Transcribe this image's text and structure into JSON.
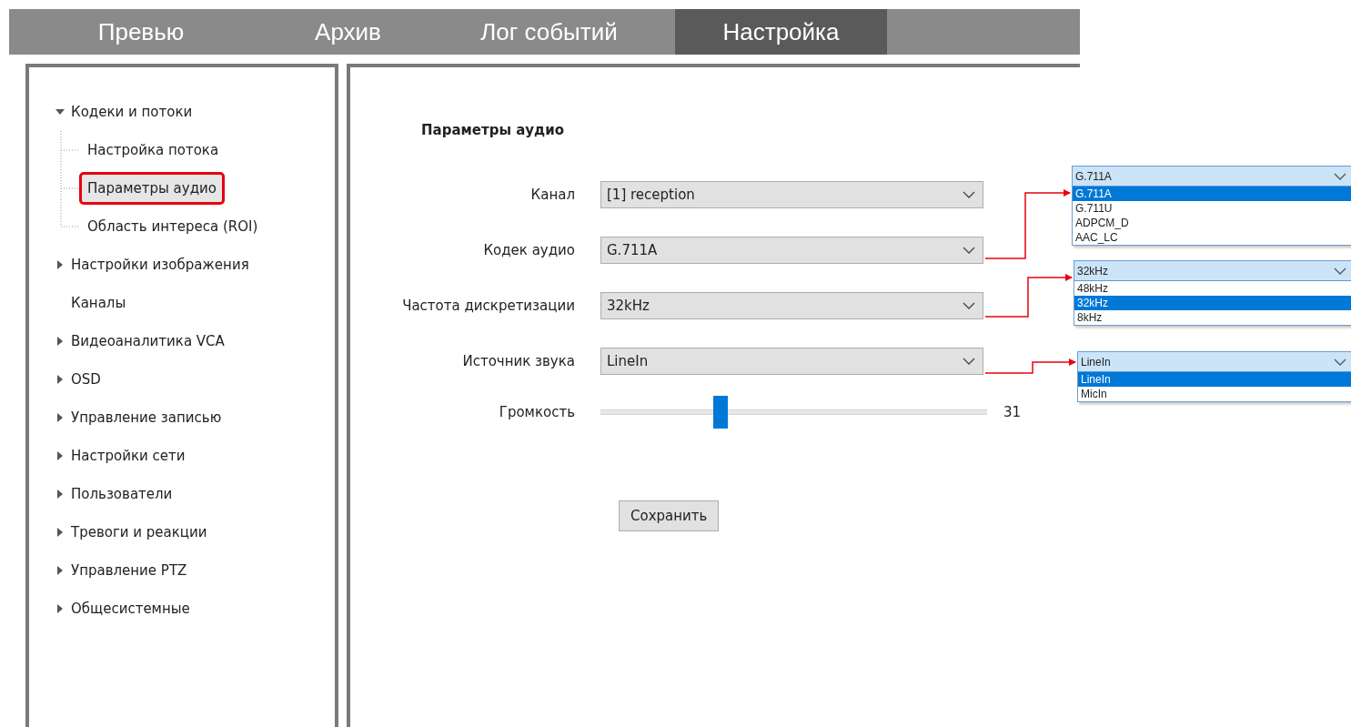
{
  "tabs": [
    {
      "label": "Превью",
      "selected": false
    },
    {
      "label": "Архив",
      "selected": false
    },
    {
      "label": "Лог событий",
      "selected": false
    },
    {
      "label": "Настройка",
      "selected": true
    }
  ],
  "sidebar": {
    "items": [
      {
        "label": "Кодеки и потоки",
        "kind": "folder",
        "expanded": true,
        "children": [
          {
            "label": "Настройка потока",
            "selected": false,
            "annotated": false
          },
          {
            "label": "Параметры аудио",
            "selected": true,
            "annotated": true
          },
          {
            "label": "Область интереса (ROI)",
            "selected": false,
            "annotated": false
          }
        ]
      },
      {
        "label": "Настройки изображения",
        "kind": "folder",
        "expanded": false
      },
      {
        "label": "Каналы",
        "kind": "leaf"
      },
      {
        "label": "Видеоаналитика VCA",
        "kind": "folder",
        "expanded": false
      },
      {
        "label": "OSD",
        "kind": "folder",
        "expanded": false
      },
      {
        "label": "Управление записью",
        "kind": "folder",
        "expanded": false
      },
      {
        "label": "Настройки сети",
        "kind": "folder",
        "expanded": false
      },
      {
        "label": "Пользователи",
        "kind": "folder",
        "expanded": false
      },
      {
        "label": "Тревоги и реакции",
        "kind": "folder",
        "expanded": false
      },
      {
        "label": "Управление PTZ",
        "kind": "folder",
        "expanded": false
      },
      {
        "label": "Общесистемные",
        "kind": "folder",
        "expanded": false
      }
    ]
  },
  "form": {
    "title": "Параметры аудио",
    "fields": [
      {
        "label": "Канал",
        "value": "[1] reception"
      },
      {
        "label": "Кодек аудио",
        "value": "G.711A",
        "callout": {
          "value": "G.711A",
          "options": [
            {
              "label": "G.711A",
              "selected": true
            },
            {
              "label": "G.711U",
              "selected": false
            },
            {
              "label": "ADPCM_D",
              "selected": false
            },
            {
              "label": "AAC_LC",
              "selected": false
            }
          ]
        }
      },
      {
        "label": "Частота дискретизации",
        "value": "32kHz",
        "callout": {
          "value": "32kHz",
          "options": [
            {
              "label": "48kHz",
              "selected": false
            },
            {
              "label": "32kHz",
              "selected": true
            },
            {
              "label": "8kHz",
              "selected": false
            }
          ]
        }
      },
      {
        "label": "Источник звука",
        "value": "LineIn",
        "callout": {
          "value": "LineIn",
          "options": [
            {
              "label": "LineIn",
              "selected": true
            },
            {
              "label": "MicIn",
              "selected": false
            }
          ]
        }
      }
    ],
    "volume": {
      "label": "Громкость",
      "level": 0.31,
      "reading": "31"
    },
    "save_button": "Сохранить"
  }
}
